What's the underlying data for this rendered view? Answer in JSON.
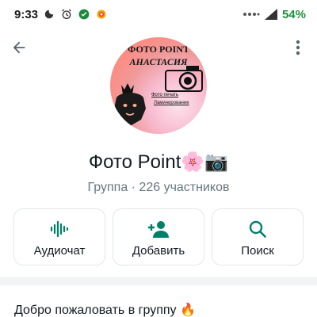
{
  "status_bar": {
    "time": "9:33",
    "battery_percent": "54%",
    "icons": [
      "moon-icon",
      "alarm-icon",
      "shield-app-icon",
      "browser-app-icon",
      "dots-icon",
      "signal-icon",
      "battery-icon"
    ]
  },
  "header": {
    "back_icon": "arrow-back-icon",
    "more_icon": "more-vertical-icon"
  },
  "avatar": {
    "line1": "ФОТО POINT",
    "line2": "АНАСТАСИЯ",
    "small1": "Фото печать",
    "small2": "Ламинирование"
  },
  "profile": {
    "name": "Фото Point🌸📷",
    "subtitle": "Группа · 226 участников"
  },
  "actions": [
    {
      "label": "Аудиочат",
      "icon": "audio-wave-icon"
    },
    {
      "label": "Добавить",
      "icon": "add-person-icon"
    },
    {
      "label": "Поиск",
      "icon": "search-icon"
    }
  ],
  "description": {
    "text": "Добро пожаловать в группу 🔥"
  },
  "colors": {
    "accent": "#008069",
    "battery": "#1e8e3e",
    "secondary_text": "#667781"
  }
}
